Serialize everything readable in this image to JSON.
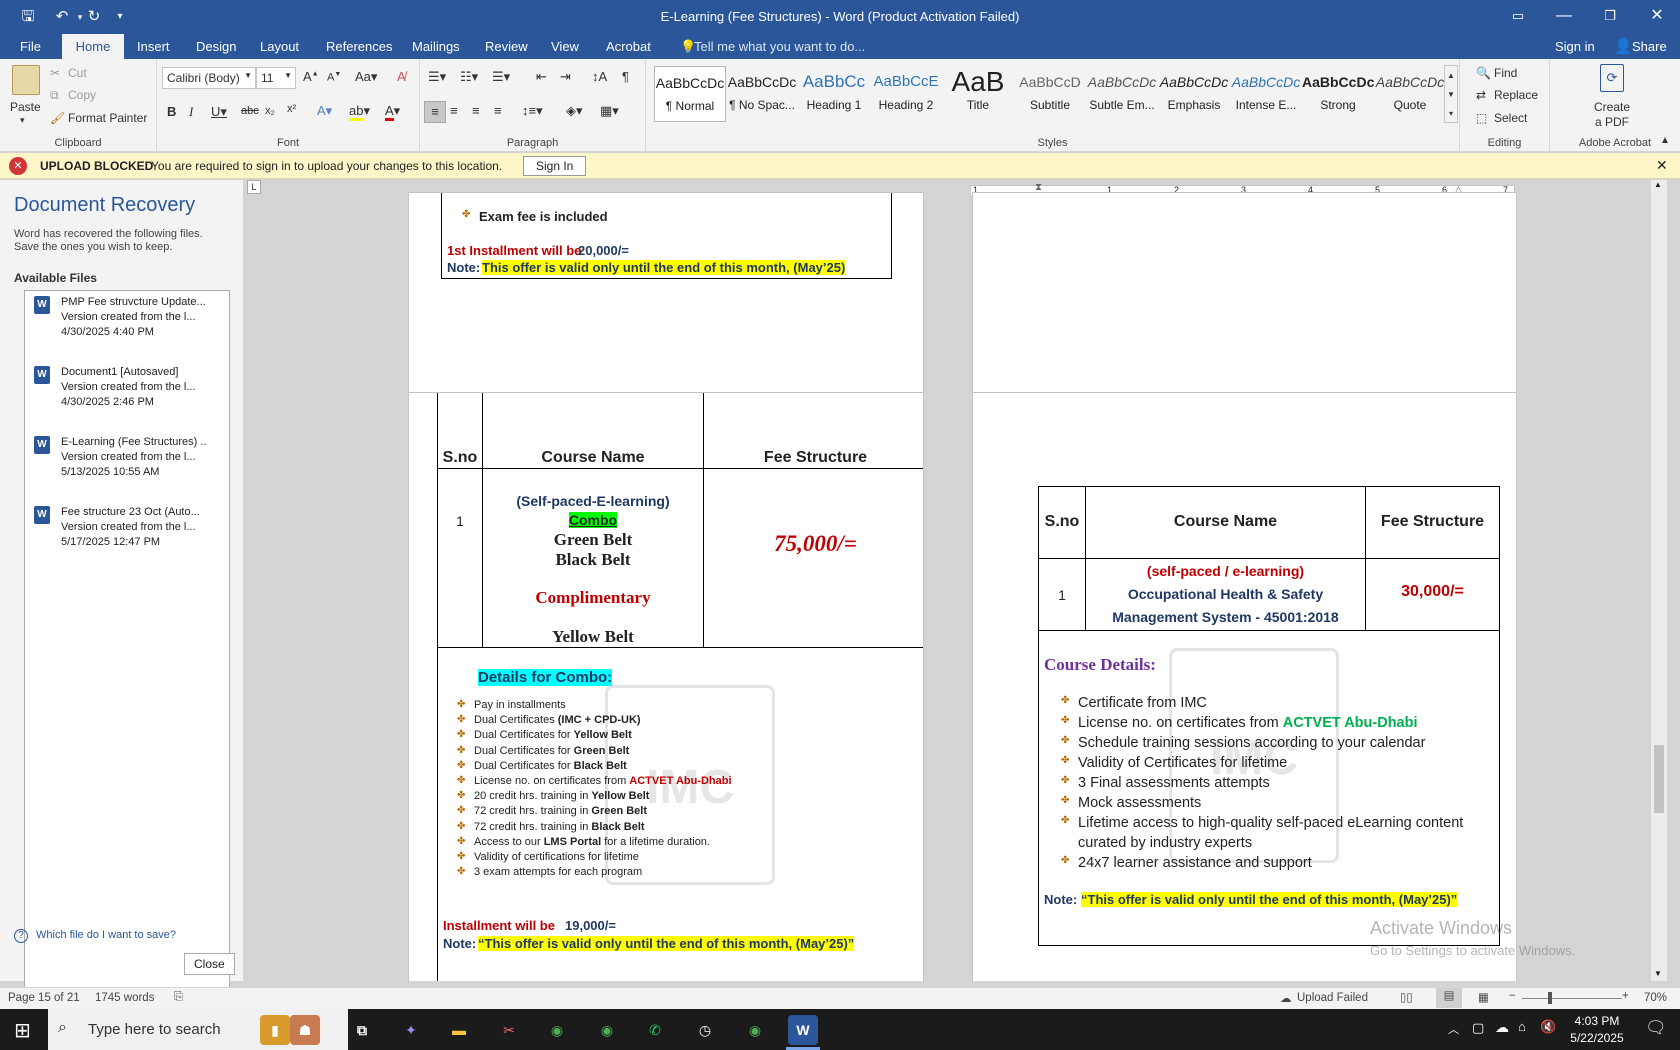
{
  "window": {
    "title": "E-Learning (Fee Structures) - Word (Product Activation Failed)"
  },
  "tabs": [
    "File",
    "Home",
    "Insert",
    "Design",
    "Layout",
    "References",
    "Mailings",
    "Review",
    "View",
    "Acrobat"
  ],
  "tell_me": "Tell me what you want to do...",
  "sign_in": "Sign in",
  "share": "Share",
  "clipboard": {
    "paste": "Paste",
    "cut": "Cut",
    "copy": "Copy",
    "format_painter": "Format Painter",
    "label": "Clipboard"
  },
  "font": {
    "name": "Calibri (Body)",
    "size": "11",
    "label": "Font"
  },
  "paragraph": {
    "label": "Paragraph"
  },
  "styles": {
    "label": "Styles",
    "items": [
      {
        "preview": "AaBbCcDc",
        "name": "¶ Normal"
      },
      {
        "preview": "AaBbCcDc",
        "name": "¶ No Spac..."
      },
      {
        "preview": "AaBbCc",
        "name": "Heading 1"
      },
      {
        "preview": "AaBbCcE",
        "name": "Heading 2"
      },
      {
        "preview": "AaB",
        "name": "Title"
      },
      {
        "preview": "AaBbCcD",
        "name": "Subtitle"
      },
      {
        "preview": "AaBbCcDc",
        "name": "Subtle Em..."
      },
      {
        "preview": "AaBbCcDc",
        "name": "Emphasis"
      },
      {
        "preview": "AaBbCcDc",
        "name": "Intense E..."
      },
      {
        "preview": "AaBbCcDc",
        "name": "Strong"
      },
      {
        "preview": "AaBbCcDc",
        "name": "Quote"
      }
    ]
  },
  "editing": {
    "find": "Find",
    "replace": "Replace",
    "select": "Select",
    "label": "Editing"
  },
  "acrobat": {
    "create": "Create",
    "a_pdf": "a PDF",
    "label": "Adobe Acrobat"
  },
  "infobar": {
    "title": "UPLOAD BLOCKED",
    "message": "You are required to sign in to upload your changes to this location.",
    "button": "Sign In"
  },
  "recovery": {
    "title": "Document Recovery",
    "desc1": "Word has recovered the following files.",
    "desc2": "Save the ones you wish to keep.",
    "available": "Available Files",
    "files": [
      {
        "name": "PMP Fee struvcture Update...",
        "line2": "Version created from the l...",
        "date": "4/30/2025 4:40 PM"
      },
      {
        "name": "Document1  [Autosaved]",
        "line2": "Version created from the l...",
        "date": "4/30/2025 2:46 PM"
      },
      {
        "name": "E-Learning (Fee Structures) ..",
        "line2": "Version created from the l...",
        "date": "5/13/2025 10:55 AM"
      },
      {
        "name": "Fee structure 23 Oct (Auto...",
        "line2": "Version created from the l...",
        "date": "5/17/2025 12:47 PM"
      }
    ],
    "help": "Which file do I want to save?",
    "close": "Close"
  },
  "page1": {
    "bullet": "Exam fee is included",
    "installment_prefix": "1st Installment will be",
    "installment_amount": "20,000/=",
    "note_label": "Note:",
    "note_text": "This offer is valid only until the end of this month, (May’25)"
  },
  "page3": {
    "headers": {
      "sno": "S.no",
      "course": "Course Name",
      "fee": "Fee Structure"
    },
    "row": {
      "sno": "1",
      "line1": "(Self-paced-E-learning)",
      "line2": "Combo",
      "line3": "Green Belt",
      "line4": "Black Belt",
      "line5": "Complimentary",
      "line6": "Yellow Belt",
      "fee": "75,000/="
    },
    "details_title": "Details for Combo:",
    "bullets": [
      {
        "pre": "Pay in installments",
        "b": "",
        "r": ""
      },
      {
        "pre": "Dual Certificates ",
        "b": "(IMC + CPD-UK)",
        "r": ""
      },
      {
        "pre": "Dual Certificates for ",
        "b": "Yellow Belt",
        "r": ""
      },
      {
        "pre": "Dual Certificates for ",
        "b": "Green Belt",
        "r": ""
      },
      {
        "pre": "Dual Certificates for ",
        "b": "Black Belt",
        "r": ""
      },
      {
        "pre": "License no. on certificates from ",
        "b": "",
        "r": "ACTVET Abu-Dhabi"
      },
      {
        "pre": "20 credit hrs. training in ",
        "b": "Yellow Belt",
        "r": ""
      },
      {
        "pre": "72 credit hrs. training in ",
        "b": "Green Belt",
        "r": ""
      },
      {
        "pre": "72 credit hrs. training in ",
        "b": "Black Belt",
        "r": ""
      },
      {
        "pre": "Access to our ",
        "b": "LMS Portal",
        "r": "",
        "post": " for a lifetime duration."
      },
      {
        "pre": "Validity of certifications for lifetime",
        "b": "",
        "r": ""
      },
      {
        "pre": "3 exam attempts for each program",
        "b": "",
        "r": ""
      }
    ],
    "installment_prefix": "Installment will be",
    "installment_amount": "19,000/=",
    "note_label": "Note:",
    "note_text": "“This offer is valid only until the end of this month, (May’25)”",
    "watermark": "IMC"
  },
  "page4": {
    "headers": {
      "sno": "S.no",
      "course": "Course Name",
      "fee": "Fee Structure"
    },
    "row": {
      "sno": "1",
      "line1": "(self-paced / e-learning)",
      "line2": "Occupational Health & Safety",
      "line3": "Management System - 45001:2018",
      "fee": "30,000/="
    },
    "details_title": "Course Details:",
    "bullets": [
      {
        "pre": "Certificate from IMC",
        "g": ""
      },
      {
        "pre": "License no. on certificates from ",
        "g": "ACTVET Abu-Dhabi"
      },
      {
        "pre": "Schedule training sessions according to your calendar",
        "g": ""
      },
      {
        "pre": "Validity of Certificates for lifetime",
        "g": ""
      },
      {
        "pre": "3 Final assessments attempts",
        "g": ""
      },
      {
        "pre": "Mock assessments",
        "g": ""
      },
      {
        "pre": "Lifetime access to high-quality self-paced eLearning content",
        "g": ""
      },
      {
        "pre": "curated by industry experts",
        "g": "",
        "cont": true
      },
      {
        "pre": "24x7 learner assistance and support",
        "g": ""
      }
    ],
    "note_label": "Note:",
    "note_text": "“This offer is valid only until the end of this month, (May’25)”",
    "watermark": "IMC"
  },
  "activate": {
    "line1": "Activate Windows",
    "line2": "Go to Settings to activate Windows."
  },
  "ruler_numbers": [
    "1",
    "1",
    "2",
    "3",
    "4",
    "5",
    "6",
    "7"
  ],
  "status": {
    "page": "Page 15 of 21",
    "words": "1745 words",
    "upload": "Upload Failed",
    "zoom": "70%"
  },
  "taskbar": {
    "search": "Type here to search",
    "time": "4:03 PM",
    "date": "5/22/2025"
  },
  "colors": {
    "accent": "#2b579a",
    "red": "#c00000",
    "navy": "#1f3864",
    "purple": "#7030a0",
    "green": "#00b050"
  }
}
